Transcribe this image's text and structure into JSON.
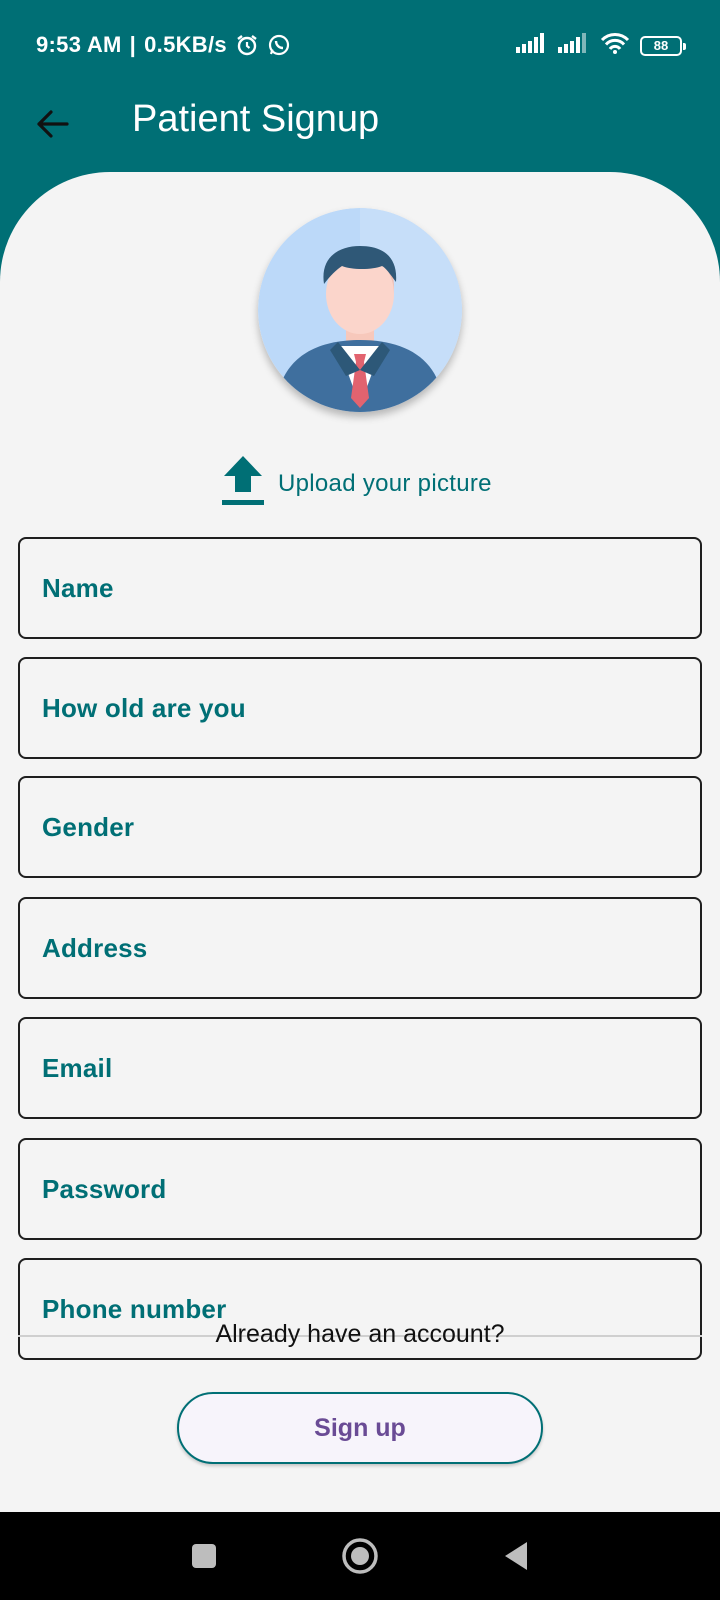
{
  "status_bar": {
    "time": "9:53 AM",
    "separator": "|",
    "speed": "0.5KB/s",
    "battery": "88",
    "icons": [
      "alarm-icon",
      "whatsapp-icon",
      "signal-icon",
      "signal-icon",
      "wifi-icon",
      "battery-icon"
    ]
  },
  "app_bar": {
    "title": "Patient Signup",
    "back_icon": "arrow-left-icon"
  },
  "avatar": {
    "icon": "user-avatar-icon"
  },
  "upload": {
    "label": "Upload your picture",
    "icon": "upload-icon"
  },
  "form": {
    "fields": [
      {
        "placeholder": "Name"
      },
      {
        "placeholder": "How old are you"
      },
      {
        "placeholder": "Gender"
      },
      {
        "placeholder": "Address"
      },
      {
        "placeholder": "Email"
      },
      {
        "placeholder": "Password"
      },
      {
        "placeholder": "Phone number"
      }
    ]
  },
  "signup_button": {
    "label": "Sign up"
  },
  "login_prompt": {
    "label": "Already have an account?"
  },
  "nav_bar": {
    "icons": [
      "recents-icon",
      "home-icon",
      "back-icon"
    ]
  },
  "colors": {
    "primary": "#006f75",
    "background": "#f4f4f4",
    "button_text": "#6a4b95"
  }
}
